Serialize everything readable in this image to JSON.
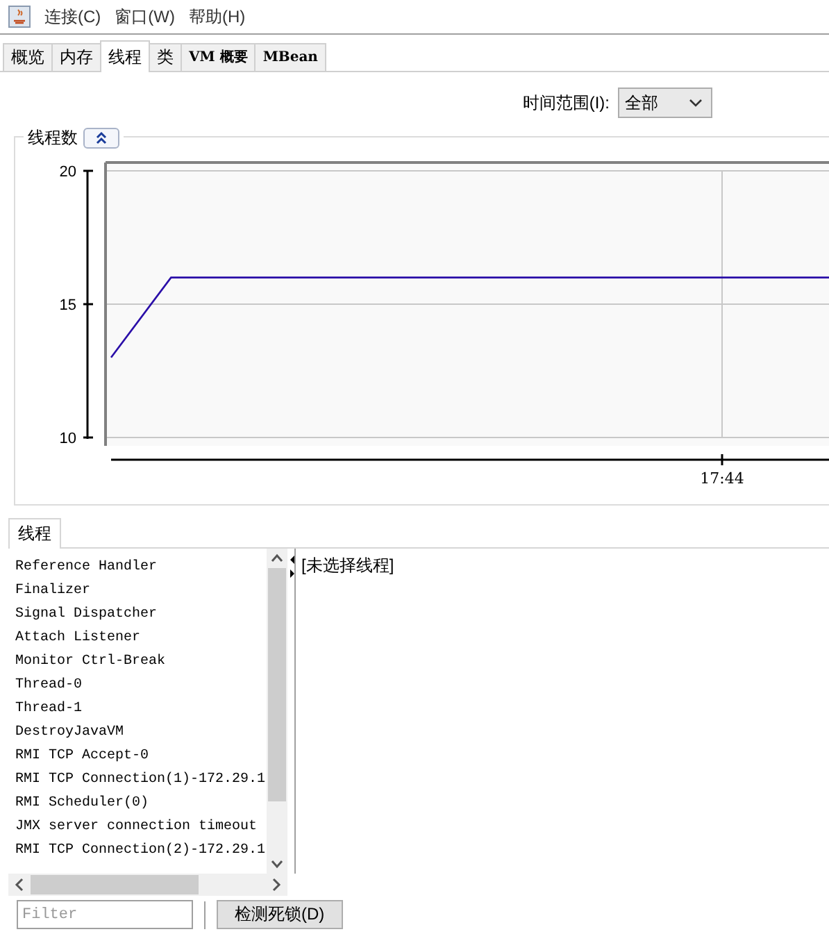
{
  "menu": [
    "连接(C)",
    "窗口(W)",
    "帮助(H)"
  ],
  "tabs": [
    {
      "label": "概览",
      "selected": false
    },
    {
      "label": "内存",
      "selected": false
    },
    {
      "label": "线程",
      "selected": true
    },
    {
      "label": "类",
      "selected": false
    },
    {
      "label": "VM 概要",
      "selected": false
    },
    {
      "label": "MBean",
      "selected": false
    }
  ],
  "time_range": {
    "label": "时间范围(I):",
    "value": "全部"
  },
  "thread_count_panel": {
    "title": "线程数",
    "expanded": true,
    "chart_data": {
      "type": "line",
      "series": [
        {
          "color": "#2a0ea8",
          "values": [
            13,
            16,
            16,
            16,
            16,
            16,
            16,
            16,
            16,
            16,
            16,
            16,
            16
          ]
        }
      ],
      "ylim": [
        10,
        20
      ],
      "yticks": [
        {
          "value": 10,
          "label": "10"
        },
        {
          "value": 15,
          "label": "15"
        },
        {
          "value": 20,
          "label": "20"
        }
      ],
      "annotations": [
        "17:44"
      ]
    }
  },
  "threads_tab": {
    "label": "线程",
    "selected": true
  },
  "threads": [
    "Reference Handler",
    "Finalizer",
    "Signal Dispatcher",
    "Attach Listener",
    "Monitor Ctrl-Break",
    "Thread-0",
    "Thread-1",
    "DestroyJavaVM",
    "RMI TCP Accept-0",
    "RMI TCP Connection(1)-172.29.1",
    "RMI Scheduler(0)",
    "JMX server connection timeout",
    "RMI TCP Connection(2)-172.29.1"
  ],
  "detail": "[未选择线程]",
  "filter": {
    "placeholder": "Filter"
  },
  "deadlock_button": "检测死锁(D)"
}
